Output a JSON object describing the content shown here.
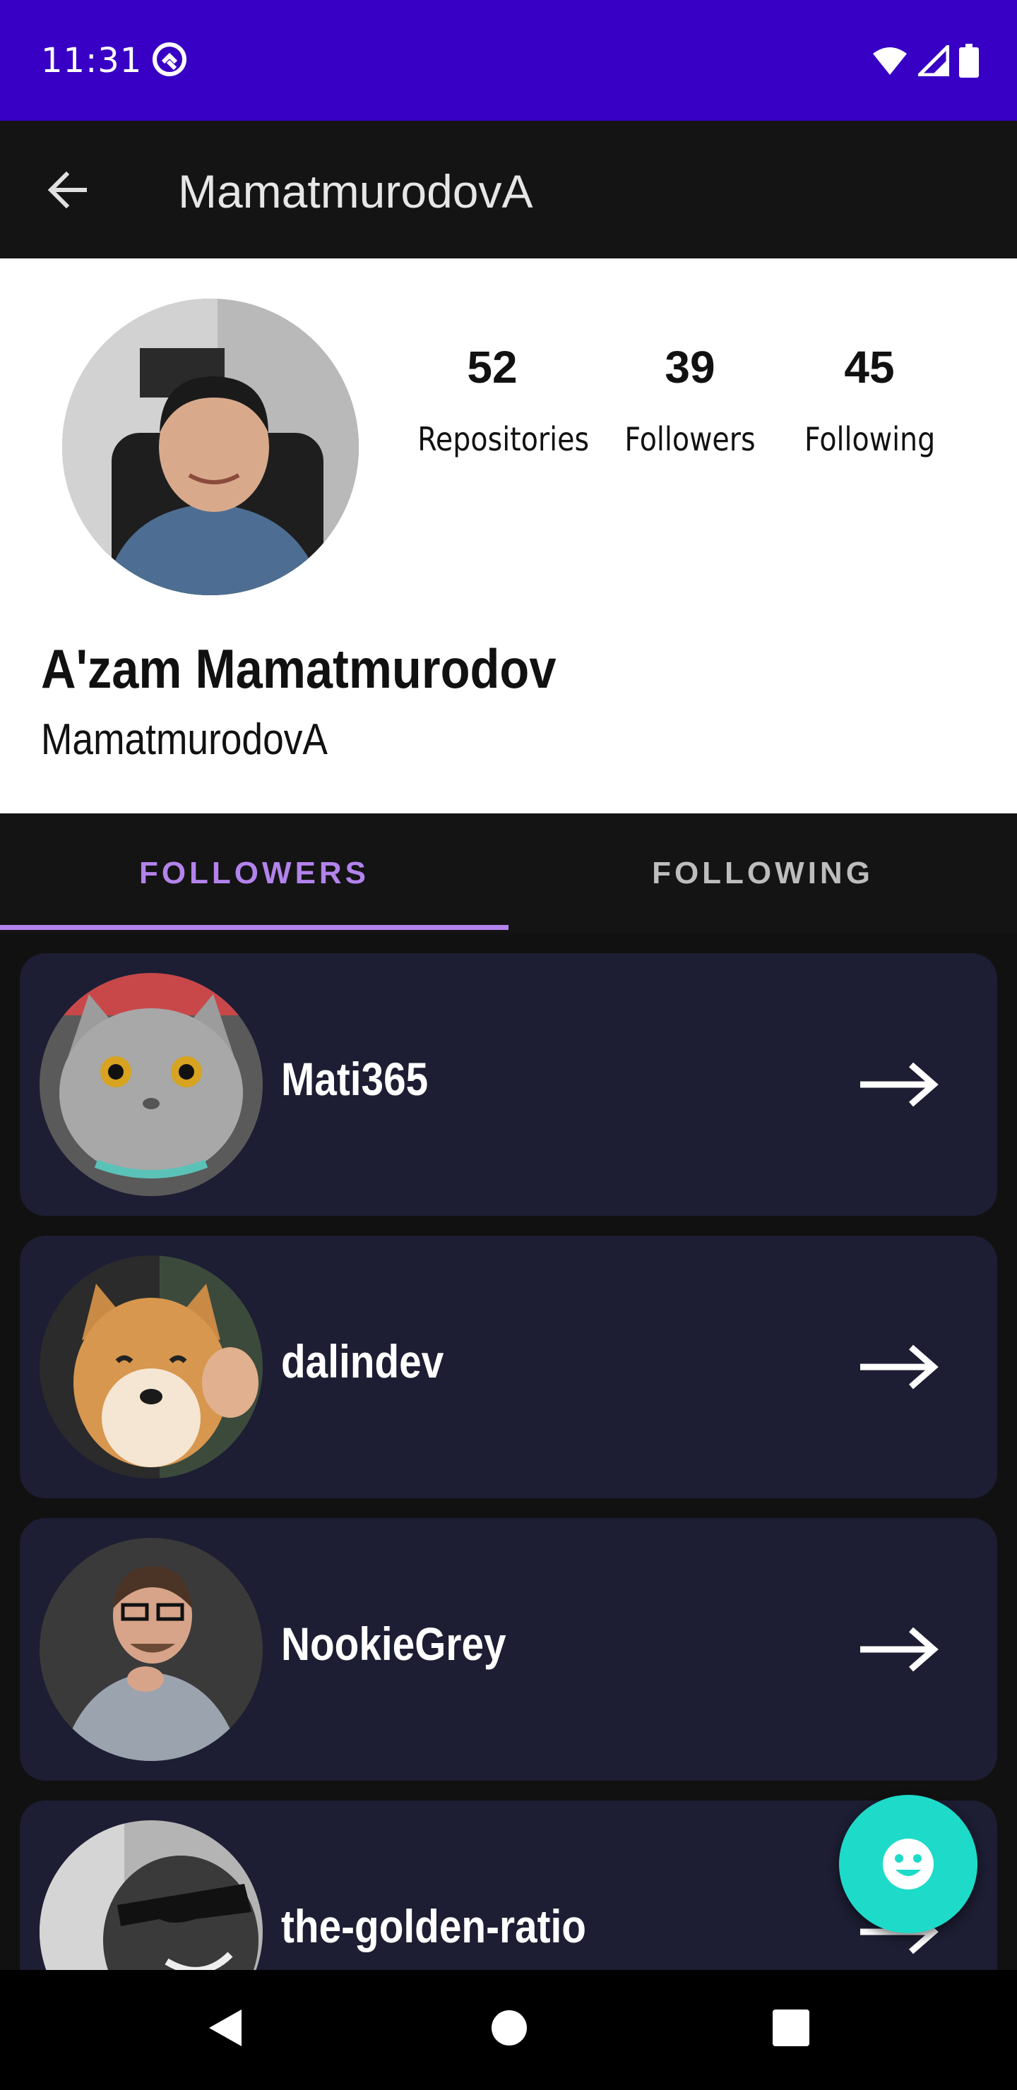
{
  "status_bar": {
    "time": "11:31",
    "background": "#3800C4"
  },
  "app_bar": {
    "title": "MamatmurodovA",
    "back_icon": "arrow-back-icon"
  },
  "profile": {
    "stats": [
      {
        "value": "52",
        "label": "Repositories"
      },
      {
        "value": "39",
        "label": "Followers"
      },
      {
        "value": "45",
        "label": "Following"
      }
    ],
    "full_name": "A'zam Mamatmurodov",
    "login": "MamatmurodovA"
  },
  "tabs": [
    {
      "label": "FOLLOWERS",
      "selected": true
    },
    {
      "label": "FOLLOWING",
      "selected": false
    }
  ],
  "followers": [
    {
      "login": "Mati365"
    },
    {
      "login": "dalindev"
    },
    {
      "login": "NookieGrey"
    },
    {
      "login": "the-golden-ratio"
    }
  ],
  "colors": {
    "accent": "#B383EC",
    "card": "#1D1D33",
    "fab": "#1DDBC8",
    "app_bar": "#141414"
  },
  "fab": {
    "icon": "smiley-face-icon"
  },
  "nav": {
    "buttons": [
      "back-triangle-icon",
      "home-circle-icon",
      "recents-square-icon"
    ]
  }
}
